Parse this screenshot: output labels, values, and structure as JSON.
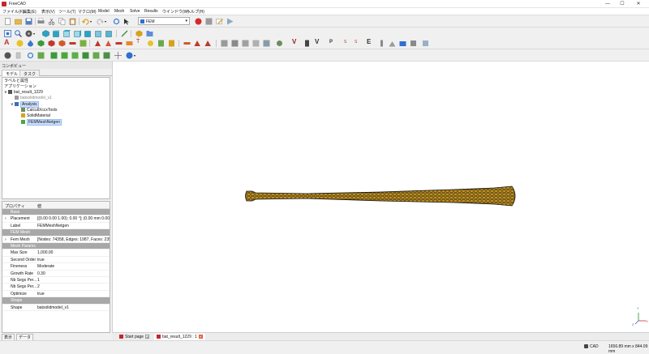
{
  "window": {
    "title": "FreeCAD",
    "min": "—",
    "max": "☐",
    "close": "✕"
  },
  "menu": [
    "ファイル(F)",
    "編集(E)",
    "表示(V)",
    "ツール(T)",
    "マクロ(M)",
    "Model",
    "Mesh",
    "Solve",
    "Results",
    "ウインドウ(W)",
    "ヘルプ(H)"
  ],
  "workbench": {
    "name": "FEM"
  },
  "combo_view": {
    "title": "コンボビュー",
    "tabs": [
      "モデル",
      "タスク"
    ],
    "tree": {
      "section_label": "ラベルと属性",
      "app_label": "アプリケーション",
      "items": [
        {
          "label": "bat_result_1229",
          "level": 0,
          "expand": "∨",
          "icon_color": "#555555"
        },
        {
          "label": "batsolidmodel_v1",
          "level": 1,
          "expand": "",
          "icon_color": "#9a9a9a",
          "dim": true
        },
        {
          "label": "Analysis",
          "level": 1,
          "expand": "∨",
          "icon_color": "#3d6fb5",
          "selected": true
        },
        {
          "label": "CalculiXccxTools",
          "level": 2,
          "expand": "",
          "icon_color": "#6b8e5a"
        },
        {
          "label": "SolidMaterial",
          "level": 2,
          "expand": "",
          "icon_color": "#d6a21e"
        },
        {
          "label": "FEMMeshNetgen",
          "level": 2,
          "expand": "",
          "icon_color": "#4aa83a",
          "selected": true
        }
      ]
    }
  },
  "properties": {
    "headers": {
      "property": "プロパティ",
      "value": "値"
    },
    "rows": [
      {
        "type": "group",
        "key": "Base"
      },
      {
        "type": "row",
        "key": "Placement",
        "value": "[(0.00 0.00 1.00); 0.00 °]; (0.00 mm  0.00 ...",
        "expand": "›"
      },
      {
        "type": "row",
        "key": "Label",
        "value": "FEMMeshNetgen"
      },
      {
        "type": "group",
        "key": "FEM Mesh"
      },
      {
        "type": "row",
        "key": "Fem Mesh",
        "value": "[Nodes: 74358, Edges: 1987, Faces: 235...",
        "expand": "›"
      },
      {
        "type": "group",
        "key": "Mesh Params"
      },
      {
        "type": "row",
        "key": "Max Size",
        "value": "1,000.00"
      },
      {
        "type": "row",
        "key": "Second Order",
        "value": "true"
      },
      {
        "type": "row",
        "key": "Fineness",
        "value": "Moderate"
      },
      {
        "type": "row",
        "key": "Growth Rate",
        "value": "0.30"
      },
      {
        "type": "row",
        "key": "Nb Segs Per...",
        "value": "1"
      },
      {
        "type": "row",
        "key": "Nb Segs Per...",
        "value": "2"
      },
      {
        "type": "row",
        "key": "Optimize",
        "value": "true"
      },
      {
        "type": "group",
        "key": "Shape"
      },
      {
        "type": "row",
        "key": "Shape",
        "value": "batsolidmodel_v1"
      }
    ]
  },
  "bottom_tabs": [
    "表示",
    "データ"
  ],
  "doc_tabs": [
    {
      "label": "Start page"
    },
    {
      "label": "bat_result_1229 : 1",
      "active": true
    }
  ],
  "status": {
    "nav": "CAD",
    "dims": "1656.89 mm x 844.09 mm"
  },
  "axis": {
    "x": "X",
    "y": "Y",
    "z": "Z"
  },
  "colors": {
    "mesh": "#c8961e",
    "mesh_edge": "#1a1a1a",
    "record": "#d42a2a",
    "selected": "#cce0ff"
  }
}
